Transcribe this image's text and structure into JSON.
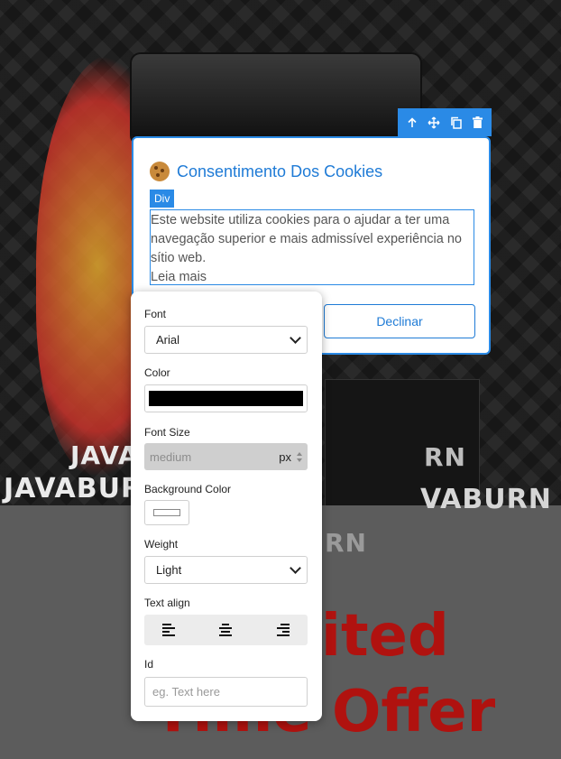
{
  "background": {
    "brand_texts": [
      "JAVA",
      "JAVABURN",
      "VABURN",
      "RN",
      "RN"
    ],
    "offer_line1": "ited",
    "offer_line2": "Time Offer"
  },
  "toolbar": {
    "icons": [
      "arrow-up-icon",
      "move-icon",
      "copy-icon",
      "trash-icon"
    ]
  },
  "cookie_popup": {
    "emoji": "cookie-icon",
    "title": "Consentimento Dos Cookies",
    "selected_tag": "Div",
    "text_line1": "Este website utiliza cookies para o ajudar a ter uma navegação superior e mais admissível experiência no sítio web.",
    "text_line2": "Leia mais",
    "decline_label": "Declinar"
  },
  "style_panel": {
    "font_label": "Font",
    "font_value": "Arial",
    "color_label": "Color",
    "color_value": "#000000",
    "font_size_label": "Font Size",
    "font_size_placeholder": "medium",
    "font_size_unit": "px",
    "bg_color_label": "Background Color",
    "weight_label": "Weight",
    "weight_value": "Light",
    "text_align_label": "Text align",
    "align_options": [
      "align-left-icon",
      "align-center-icon",
      "align-right-icon"
    ],
    "id_label": "Id",
    "id_placeholder": "eg. Text here"
  },
  "colors": {
    "accent": "#2a8ae6",
    "title_blue": "#1f7bd6",
    "offer_red": "#b0120f"
  }
}
